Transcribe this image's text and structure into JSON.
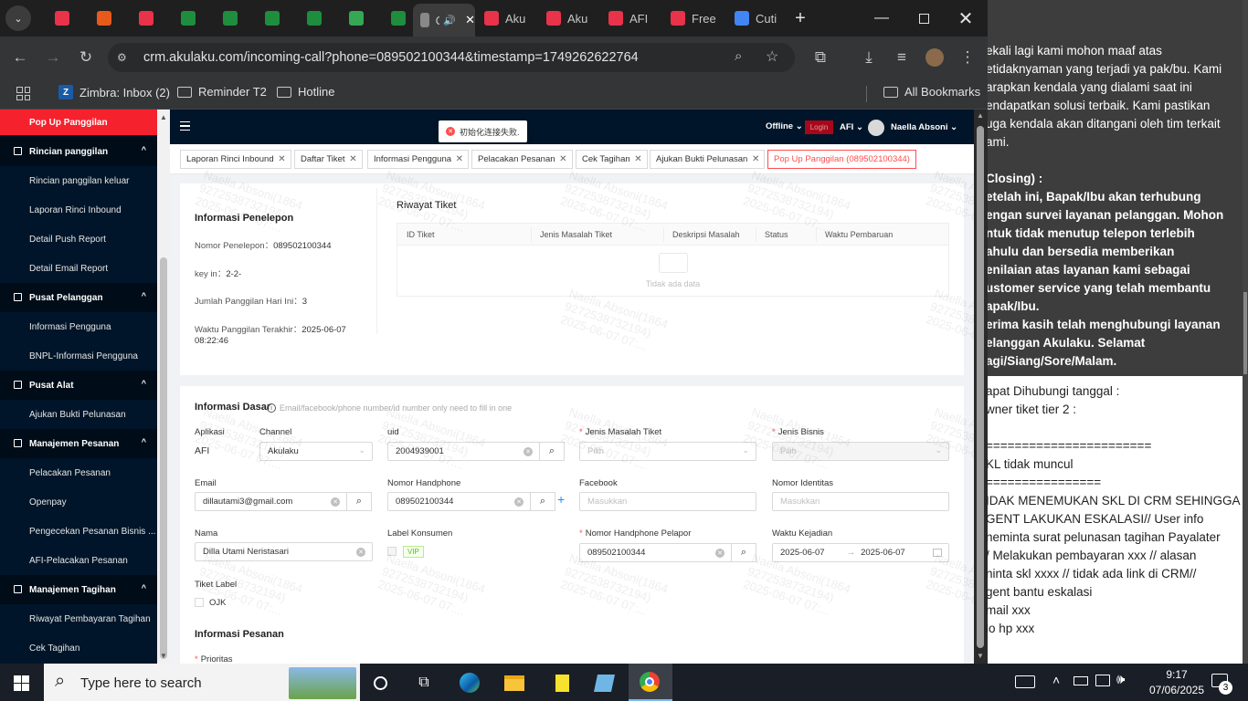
{
  "browser": {
    "tabs": [
      {
        "label": "",
        "icon": "red-app-icon",
        "color": "#e8334a"
      },
      {
        "label": "",
        "icon": "orange-castle-icon",
        "color": "#e85a1c"
      },
      {
        "label": "",
        "icon": "red-check-icon",
        "color": "#e8334a"
      },
      {
        "label": "",
        "icon": "green-sheet-icon",
        "color": "#1e8e3e"
      },
      {
        "label": "",
        "icon": "green-sheet-icon",
        "color": "#1e8e3e"
      },
      {
        "label": "",
        "icon": "green-sheet-icon",
        "color": "#1e8e3e"
      },
      {
        "label": "",
        "icon": "green-sheet-icon",
        "color": "#1e8e3e"
      },
      {
        "label": "",
        "icon": "colorful-app-icon",
        "color": "#34a853"
      },
      {
        "label": "",
        "icon": "green-sheet-icon",
        "color": "#1e8e3e"
      },
      {
        "label": "C",
        "icon": "loading-icon",
        "color": "#888888"
      },
      {
        "label": "Aku",
        "icon": "akulaku-icon",
        "color": "#e8334a"
      },
      {
        "label": "Aku",
        "icon": "akulaku-icon",
        "color": "#e8334a"
      },
      {
        "label": "AFI",
        "icon": "afi-icon",
        "color": "#e8334a"
      },
      {
        "label": "Free",
        "icon": "free-icon",
        "color": "#e8334a"
      },
      {
        "label": "Cuti",
        "icon": "cuti-icon",
        "color": "#4285f4"
      }
    ],
    "url": "crm.akulaku.com/incoming-call?phone=089502100344&timestamp=1749262622764",
    "bookmarks": {
      "zimbra": "Zimbra: Inbox (2)",
      "reminder": "Reminder T2",
      "hotline": "Hotline",
      "all": "All Bookmarks"
    }
  },
  "sidebar": {
    "active": "Pop Up Panggilan",
    "sections": [
      {
        "header": "Rincian panggilan",
        "items": [
          "Rincian panggilan keluar",
          "Laporan Rinci Inbound",
          "Detail Push Report",
          "Detail Email Report"
        ]
      },
      {
        "header": "Pusat Pelanggan",
        "items": [
          "Informasi Pengguna",
          "BNPL-Informasi Pengguna"
        ]
      },
      {
        "header": "Pusat Alat",
        "items": [
          "Ajukan Bukti Pelunasan"
        ]
      },
      {
        "header": "Manajemen Pesanan",
        "items": [
          "Pelacakan Pesanan",
          "Openpay",
          "Pengecekan Pesanan Bisnis ...",
          "AFI-Pelacakan Pesanan"
        ]
      },
      {
        "header": "Manajemen Tagihan",
        "items": [
          "Riwayat Pembayaran Tagihan",
          "Cek Tagihan"
        ]
      }
    ]
  },
  "topnav": {
    "toast": "初始化连接失败.",
    "status": "Offline",
    "login": "Login",
    "region": "AFI",
    "user": "Naella Absoni"
  },
  "page_tabs": [
    "Laporan Rinci Inbound",
    "Daftar Tiket",
    "Informasi Pengguna",
    "Pelacakan Pesanan",
    "Cek Tagihan",
    "Ajukan Bukti Pelunasan",
    "Pop Up Panggilan (089502100344)"
  ],
  "caller": {
    "title": "Informasi Penelepon",
    "phone_label": "Nomor Penelepon：",
    "phone": "089502100344",
    "key_label": "key in：",
    "key": "2-2-",
    "count_label": "Jumlah Panggilan Hari Ini：",
    "count": "3",
    "last_label": "Waktu Panggilan Terakhir：",
    "last_date": "2025-06-07",
    "last_time": "08:22:46"
  },
  "tickets": {
    "title": "Riwayat Tiket",
    "columns": [
      "ID Tiket",
      "Jenis Masalah Tiket",
      "Deskripsi Masalah",
      "Status",
      "Waktu Pembaruan"
    ],
    "empty": "Tidak ada data"
  },
  "basic": {
    "title": "Informasi Dasar",
    "hint": "Email/facebook/phone number/id number only need to fill in one",
    "aplikasi_label": "Aplikasi",
    "aplikasi": "AFI",
    "channel_label": "Channel",
    "channel": "Akulaku",
    "uid_label": "uid",
    "uid": "2004939001",
    "jenis_masalah_label": "Jenis Masalah Tiket",
    "jenis_masalah_ph": "Pilih",
    "jenis_bisnis_label": "Jenis Bisnis",
    "jenis_bisnis_ph": "Pilih",
    "email_label": "Email",
    "email": "dillautami3@gmail.com",
    "hp_label": "Nomor Handphone",
    "hp": "089502100344",
    "fb_label": "Facebook",
    "fb_ph": "Masukkan",
    "id_label": "Nomor Identitas",
    "id_ph": "Masukkan",
    "nama_label": "Nama",
    "nama": "Dilla Utami Neristasari",
    "label_konsumen": "Label Konsumen",
    "vip": "VIP",
    "pelapor_label": "Nomor Handphone Pelapor",
    "pelapor": "089502100344",
    "waktu_label": "Waktu Kejadian",
    "waktu_from": "2025-06-07",
    "waktu_to": "2025-06-07",
    "tiket_label": "Tiket Label",
    "ojk": "OJK"
  },
  "order": {
    "title": "Informasi Pesanan",
    "prioritas": "Prioritas"
  },
  "watermark": "Naella Absoni(1864\n9272538732194)\n2025-06-07 07:...",
  "notes_dark": [
    "ekali lagi kami mohon maaf atas",
    "etidaknyaman yang terjadi ya pak/bu. Kami",
    "arapkan kendala yang dialami saat ini",
    "endapatkan solusi terbaik. Kami pastikan",
    "uga kendala akan ditangani oleh tim terkait",
    "ami.",
    "",
    "Closing) :",
    "etelah ini, Bapak/Ibu akan terhubung",
    "engan survei layanan pelanggan. Mohon",
    "ntuk tidak menutup telepon terlebih",
    "ahulu dan bersedia memberikan",
    "enilaian atas layanan kami sebagai",
    "ustomer service yang telah membantu",
    "apak/Ibu.",
    "erima kasih telah menghubungi layanan",
    "elanggan Akulaku. Selamat",
    "agi/Siang/Sore/Malam."
  ],
  "notes_light": [
    "apat Dihubungi tanggal :",
    "wner tiket tier 2 :",
    "",
    " =======================",
    "KL tidak muncul",
    " ================",
    "IDAK MENEMUKAN SKL DI CRM SEHINGGA",
    "GENT LAKUKAN ESKALASI// User info",
    "neminta surat pelunasan tagihan Payalater",
    "/ Melakukan pembayaran xxx // alasan",
    "ninta skl xxxx // tidak ada link di CRM//",
    "gent bantu eskalasi",
    "mail xxx",
    "lo hp xxx"
  ],
  "taskbar": {
    "search": "Type here to search",
    "time": "9:17",
    "date": "07/06/2025",
    "notif": "3"
  }
}
